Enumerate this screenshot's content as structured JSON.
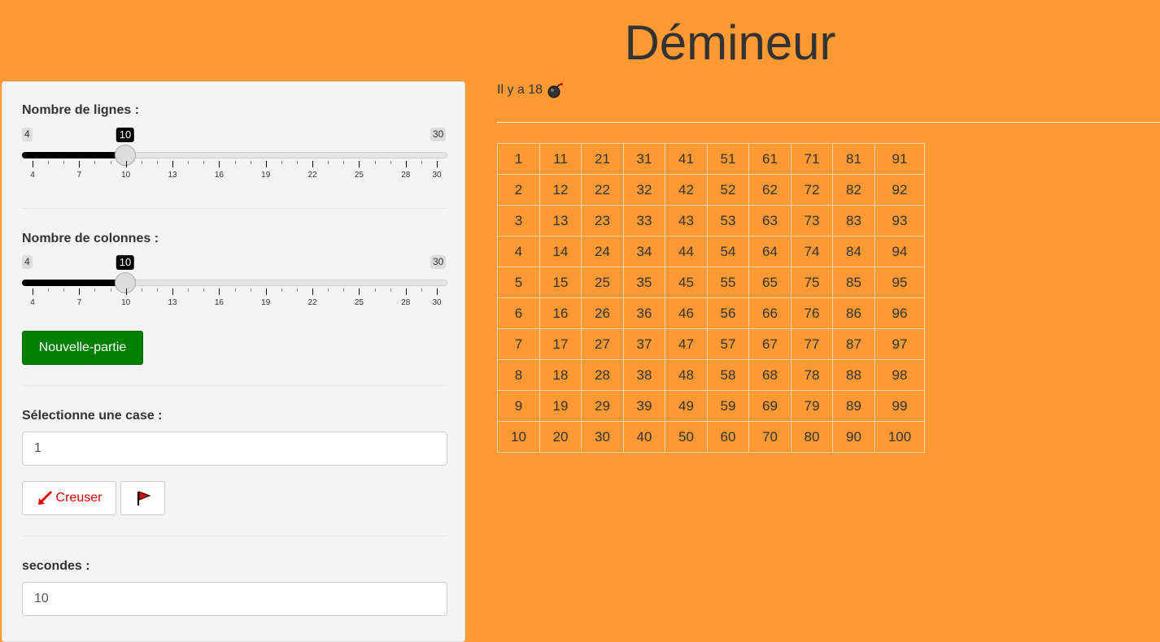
{
  "header": {
    "title": "Démineur"
  },
  "status": {
    "bomb_text": "Il y a 18",
    "bomb_icon": "bomb-icon"
  },
  "sidebar": {
    "rows_slider": {
      "label": "Nombre de lignes :",
      "min": "4",
      "max": "30",
      "value": "10",
      "ticks": [
        "4",
        "7",
        "10",
        "13",
        "16",
        "19",
        "22",
        "25",
        "28",
        "30"
      ]
    },
    "cols_slider": {
      "label": "Nombre de colonnes :",
      "min": "4",
      "max": "30",
      "value": "10",
      "ticks": [
        "4",
        "7",
        "10",
        "13",
        "16",
        "19",
        "22",
        "25",
        "28",
        "30"
      ]
    },
    "new_game_label": "Nouvelle-partie",
    "select_label": "Sélectionne une case :",
    "select_value": "1",
    "dig_label": "Creuser",
    "dig_icon": "shovel-icon",
    "flag_icon": "flag-icon",
    "seconds_label": "secondes :",
    "seconds_value": "10"
  },
  "grid": {
    "rows": [
      [
        "1",
        "11",
        "21",
        "31",
        "41",
        "51",
        "61",
        "71",
        "81",
        "91"
      ],
      [
        "2",
        "12",
        "22",
        "32",
        "42",
        "52",
        "62",
        "72",
        "82",
        "92"
      ],
      [
        "3",
        "13",
        "23",
        "33",
        "43",
        "53",
        "63",
        "73",
        "83",
        "93"
      ],
      [
        "4",
        "14",
        "24",
        "34",
        "44",
        "54",
        "64",
        "74",
        "84",
        "94"
      ],
      [
        "5",
        "15",
        "25",
        "35",
        "45",
        "55",
        "65",
        "75",
        "85",
        "95"
      ],
      [
        "6",
        "16",
        "26",
        "36",
        "46",
        "56",
        "66",
        "76",
        "86",
        "96"
      ],
      [
        "7",
        "17",
        "27",
        "37",
        "47",
        "57",
        "67",
        "77",
        "87",
        "97"
      ],
      [
        "8",
        "18",
        "28",
        "38",
        "48",
        "58",
        "68",
        "78",
        "88",
        "98"
      ],
      [
        "9",
        "19",
        "29",
        "39",
        "49",
        "59",
        "69",
        "79",
        "89",
        "99"
      ],
      [
        "10",
        "20",
        "30",
        "40",
        "50",
        "60",
        "70",
        "80",
        "90",
        "100"
      ]
    ]
  },
  "colors": {
    "background": "#ff9933",
    "accent_button": "#008000",
    "dig_text": "#e00000"
  }
}
